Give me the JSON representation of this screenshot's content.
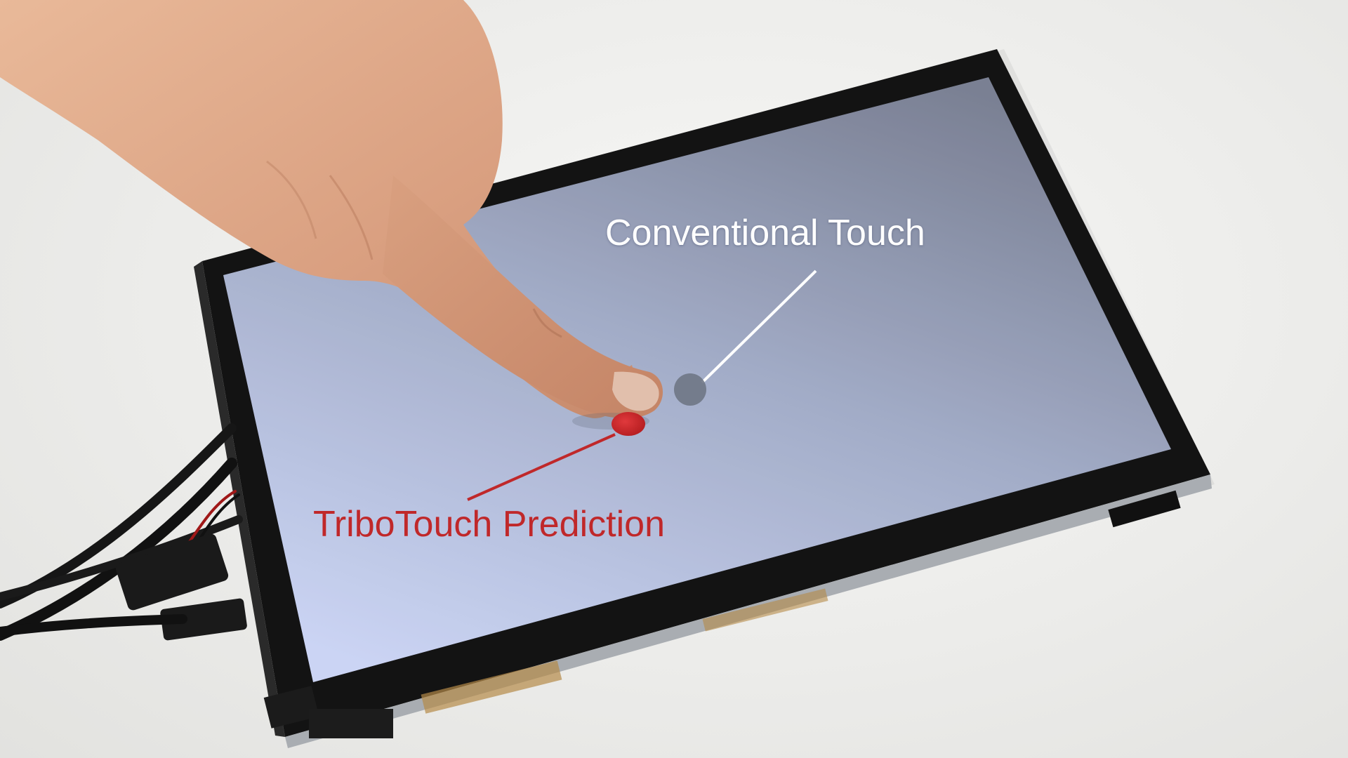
{
  "annotations": {
    "conventional_touch": "Conventional Touch",
    "tribotouch_prediction": "TriboTouch Prediction"
  },
  "colors": {
    "conventional_marker": "#6f7785",
    "prediction_marker": "#c62a2d",
    "conventional_label": "#ffffff",
    "prediction_label": "#c0282a",
    "screen_top": "#7c8396",
    "screen_bottom": "#c6d0f2",
    "bezel": "#141414"
  },
  "icons": {
    "hand": "pointing-hand-icon",
    "conventional_marker": "grey-dot-icon",
    "prediction_marker": "red-dot-icon"
  }
}
